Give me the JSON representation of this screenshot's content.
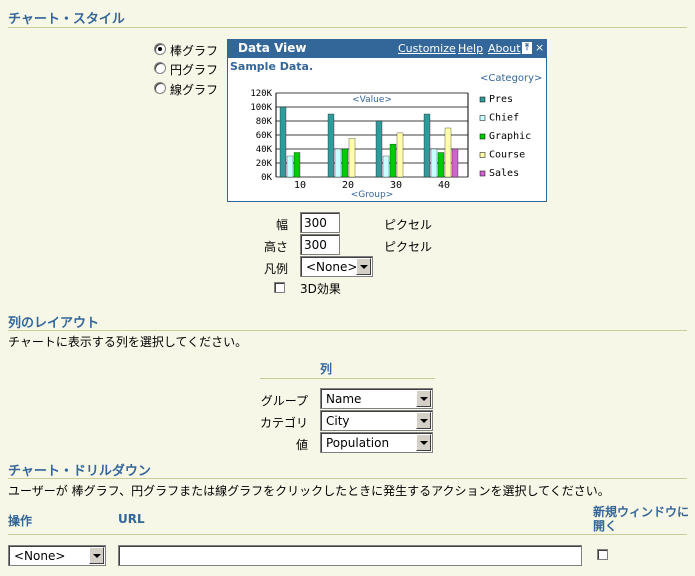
{
  "chart_style": {
    "title": "チャート・スタイル",
    "options": [
      {
        "label": "棒グラフ",
        "selected": true
      },
      {
        "label": "円グラフ",
        "selected": false
      },
      {
        "label": "線グラフ",
        "selected": false
      }
    ],
    "preview": {
      "titlebar": "Data View",
      "links": [
        "Customize",
        "Help",
        "About"
      ],
      "subtitle": "Sample Data.",
      "category_label": "<Category>",
      "value_label": "<Value>",
      "group_label": "<Group>"
    },
    "width_label": "幅",
    "width_value": "300",
    "height_label": "高さ",
    "height_value": "300",
    "unit": "ピクセル",
    "legend_label": "凡例",
    "legend_value": "<None>",
    "effect_label": "3D効果"
  },
  "chart_data": {
    "type": "bar",
    "categories": [
      "10",
      "20",
      "30",
      "40"
    ],
    "ylim": [
      0,
      120000
    ],
    "yticks": [
      "0K",
      "20K",
      "40K",
      "60K",
      "80K",
      "100K",
      "120K"
    ],
    "series": [
      {
        "name": "Pres",
        "color": "#339999",
        "values": [
          100000,
          90000,
          80000,
          90000
        ]
      },
      {
        "name": "Chief",
        "color": "#ccffff",
        "values": [
          30000,
          40000,
          30000,
          40000
        ]
      },
      {
        "name": "Graphic",
        "color": "#00cc00",
        "values": [
          35000,
          40000,
          47000,
          35000
        ]
      },
      {
        "name": "Course",
        "color": "#ffffaa",
        "values": [
          0,
          55000,
          63000,
          70000
        ]
      },
      {
        "name": "Sales",
        "color": "#cc66cc",
        "values": [
          0,
          0,
          0,
          40000
        ]
      }
    ]
  },
  "column_layout": {
    "title": "列のレイアウト",
    "description": "チャートに表示する列を選択してください。",
    "column_header": "列",
    "rows": [
      {
        "label": "グループ",
        "value": "Name"
      },
      {
        "label": "カテゴリ",
        "value": "City"
      },
      {
        "label": "値",
        "value": "Population"
      }
    ]
  },
  "drilldown": {
    "title": "チャート・ドリルダウン",
    "description": "ユーザーが 棒グラフ、円グラフまたは線グラフをクリックしたときに発生するアクションを選択してください。",
    "col_action": "操作",
    "col_url": "URL",
    "col_new_window": "新規ウィンドウに開く",
    "action_value": "<None>",
    "url_value": ""
  },
  "colors": {
    "accent": "#336699",
    "background": "#f7f7e7",
    "rule": "#cccc99"
  }
}
